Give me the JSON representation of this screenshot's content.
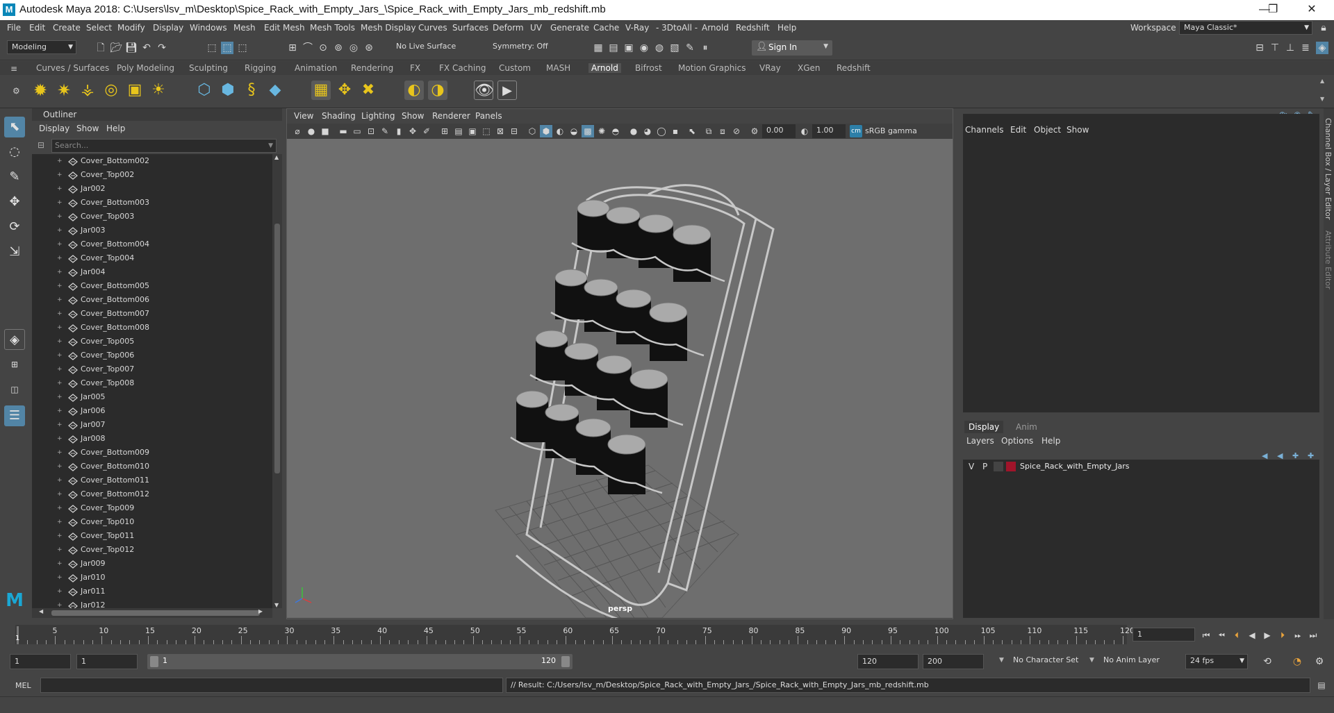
{
  "window": {
    "title": "Autodesk Maya 2018: C:\\Users\\lsv_m\\Desktop\\Spice_Rack_with_Empty_Jars_\\Spice_Rack_with_Empty_Jars_mb_redshift.mb",
    "logo": "M",
    "minimize": "—",
    "restore": "❐",
    "close": "✕"
  },
  "menubar": {
    "items": [
      "File",
      "Edit",
      "Create",
      "Select",
      "Modify",
      "Display",
      "Windows",
      "Mesh",
      "Edit Mesh",
      "Mesh Tools",
      "Mesh Display",
      "Curves",
      "Surfaces",
      "Deform",
      "UV",
      "Generate",
      "Cache",
      "V-Ray",
      "- 3DtoAll -",
      "Arnold",
      "Redshift",
      "Help"
    ],
    "workspace_label": "Workspace :",
    "workspace_value": "Maya Classic*"
  },
  "statusline": {
    "mode": "Modeling",
    "live_surface": "No Live Surface",
    "symmetry": "Symmetry: Off",
    "sign_in": "Sign In"
  },
  "shelf": {
    "tabs": [
      "Curves / Surfaces",
      "Poly Modeling",
      "Sculpting",
      "Rigging",
      "Animation",
      "Rendering",
      "FX",
      "FX Caching",
      "Custom",
      "MASH",
      "Arnold",
      "Bifrost",
      "Motion Graphics",
      "VRay",
      "XGen",
      "Redshift"
    ],
    "active_tab": "Arnold"
  },
  "outliner": {
    "title": "Outliner",
    "menu": [
      "Display",
      "Show",
      "Help"
    ],
    "search_placeholder": "Search...",
    "items": [
      "Cover_Bottom002",
      "Cover_Top002",
      "Jar002",
      "Cover_Bottom003",
      "Cover_Top003",
      "Jar003",
      "Cover_Bottom004",
      "Cover_Top004",
      "Jar004",
      "Cover_Bottom005",
      "Cover_Bottom006",
      "Cover_Bottom007",
      "Cover_Bottom008",
      "Cover_Top005",
      "Cover_Top006",
      "Cover_Top007",
      "Cover_Top008",
      "Jar005",
      "Jar006",
      "Jar007",
      "Jar008",
      "Cover_Bottom009",
      "Cover_Bottom010",
      "Cover_Bottom011",
      "Cover_Bottom012",
      "Cover_Top009",
      "Cover_Top010",
      "Cover_Top011",
      "Cover_Top012",
      "Jar009",
      "Jar010",
      "Jar011",
      "Jar012"
    ]
  },
  "viewport": {
    "menu": [
      "View",
      "Shading",
      "Lighting",
      "Show",
      "Renderer",
      "Panels"
    ],
    "exposure": "0.00",
    "gamma": "1.00",
    "color_space": "sRGB gamma",
    "camera": "persp"
  },
  "channelbox": {
    "menu": [
      "Channels",
      "Edit",
      "Object",
      "Show"
    ],
    "side_tab_1": "Channel Box / Layer Editor",
    "side_tab_2": "Attribute Editor"
  },
  "layers": {
    "tabs": [
      "Display",
      "Anim"
    ],
    "menu": [
      "Layers",
      "Options",
      "Help"
    ],
    "rows": [
      {
        "v": "V",
        "p": "P",
        "name": "Spice_Rack_with_Empty_Jars",
        "color": "#a0142a"
      }
    ]
  },
  "timeslider": {
    "ticks": [
      "5",
      "10",
      "15",
      "20",
      "25",
      "30",
      "35",
      "40",
      "45",
      "50",
      "55",
      "60",
      "65",
      "70",
      "75",
      "80",
      "85",
      "90",
      "95",
      "100",
      "105",
      "110",
      "115",
      "120"
    ],
    "current": "1",
    "current_frame_field": "1"
  },
  "range": {
    "start": "1",
    "anim_start": "1",
    "range_start": "1",
    "range_end": "120",
    "anim_end": "120",
    "end": "200",
    "character_set": "No Character Set",
    "anim_layer": "No Anim Layer",
    "fps": "24 fps"
  },
  "commandline": {
    "lang": "MEL",
    "result": "// Result: C:/Users/lsv_m/Desktop/Spice_Rack_with_Empty_Jars_/Spice_Rack_with_Empty_Jars_mb_redshift.mb"
  }
}
